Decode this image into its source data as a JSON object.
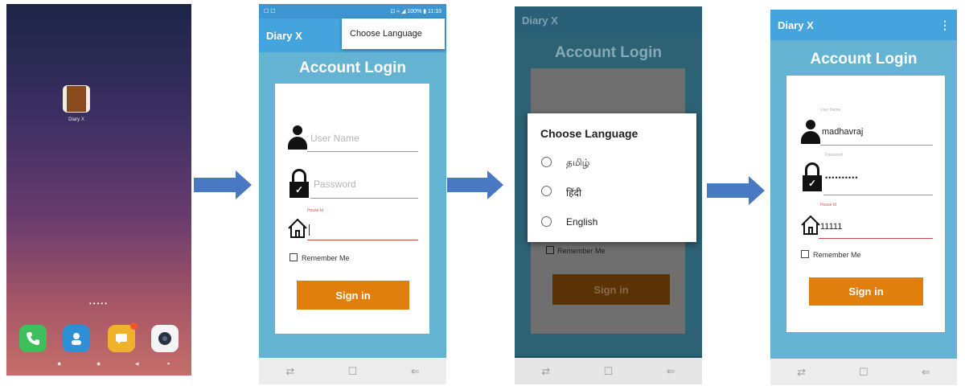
{
  "home": {
    "app_name": "Diary X",
    "page_dots": "•••••",
    "dock": [
      "phone-app",
      "contacts-app",
      "messages-app",
      "camera-app"
    ]
  },
  "screen2": {
    "status_left": "☐ ☐",
    "status_right": "⊡ ≈ ◢ 100% ▮ 11:33",
    "app_title": "Diary X",
    "menu_item": "Choose Language",
    "heading": "Account Login",
    "username_placeholder": "User Name",
    "password_placeholder": "Password",
    "house_label": "House Id",
    "remember_label": "Remember Me",
    "signin_label": "Sign in"
  },
  "screen3": {
    "app_title": "Diary X",
    "heading": "Account Login",
    "dialog_title": "Choose Language",
    "options": [
      "தமிழ்",
      "हिंदी",
      "English"
    ],
    "remember_label": "Remember Me",
    "signin_label": "Sign in"
  },
  "screen4": {
    "app_title": "Diary X",
    "menu_icon": "⋮",
    "heading": "Account Login",
    "username_label": "User Name",
    "username_value": "madhavraj",
    "password_label": "Password",
    "password_value": "••••••••••",
    "house_label": "House Id",
    "house_value": "11111",
    "remember_label": "Remember Me",
    "signin_label": "Sign in"
  },
  "navbar": {
    "recent": "⇄",
    "home": "☐",
    "back": "⇐"
  },
  "colors": {
    "appbar": "#45a4de",
    "background": "#64b3d3",
    "signin": "#e07f0b",
    "arrow": "#4a79c4"
  }
}
